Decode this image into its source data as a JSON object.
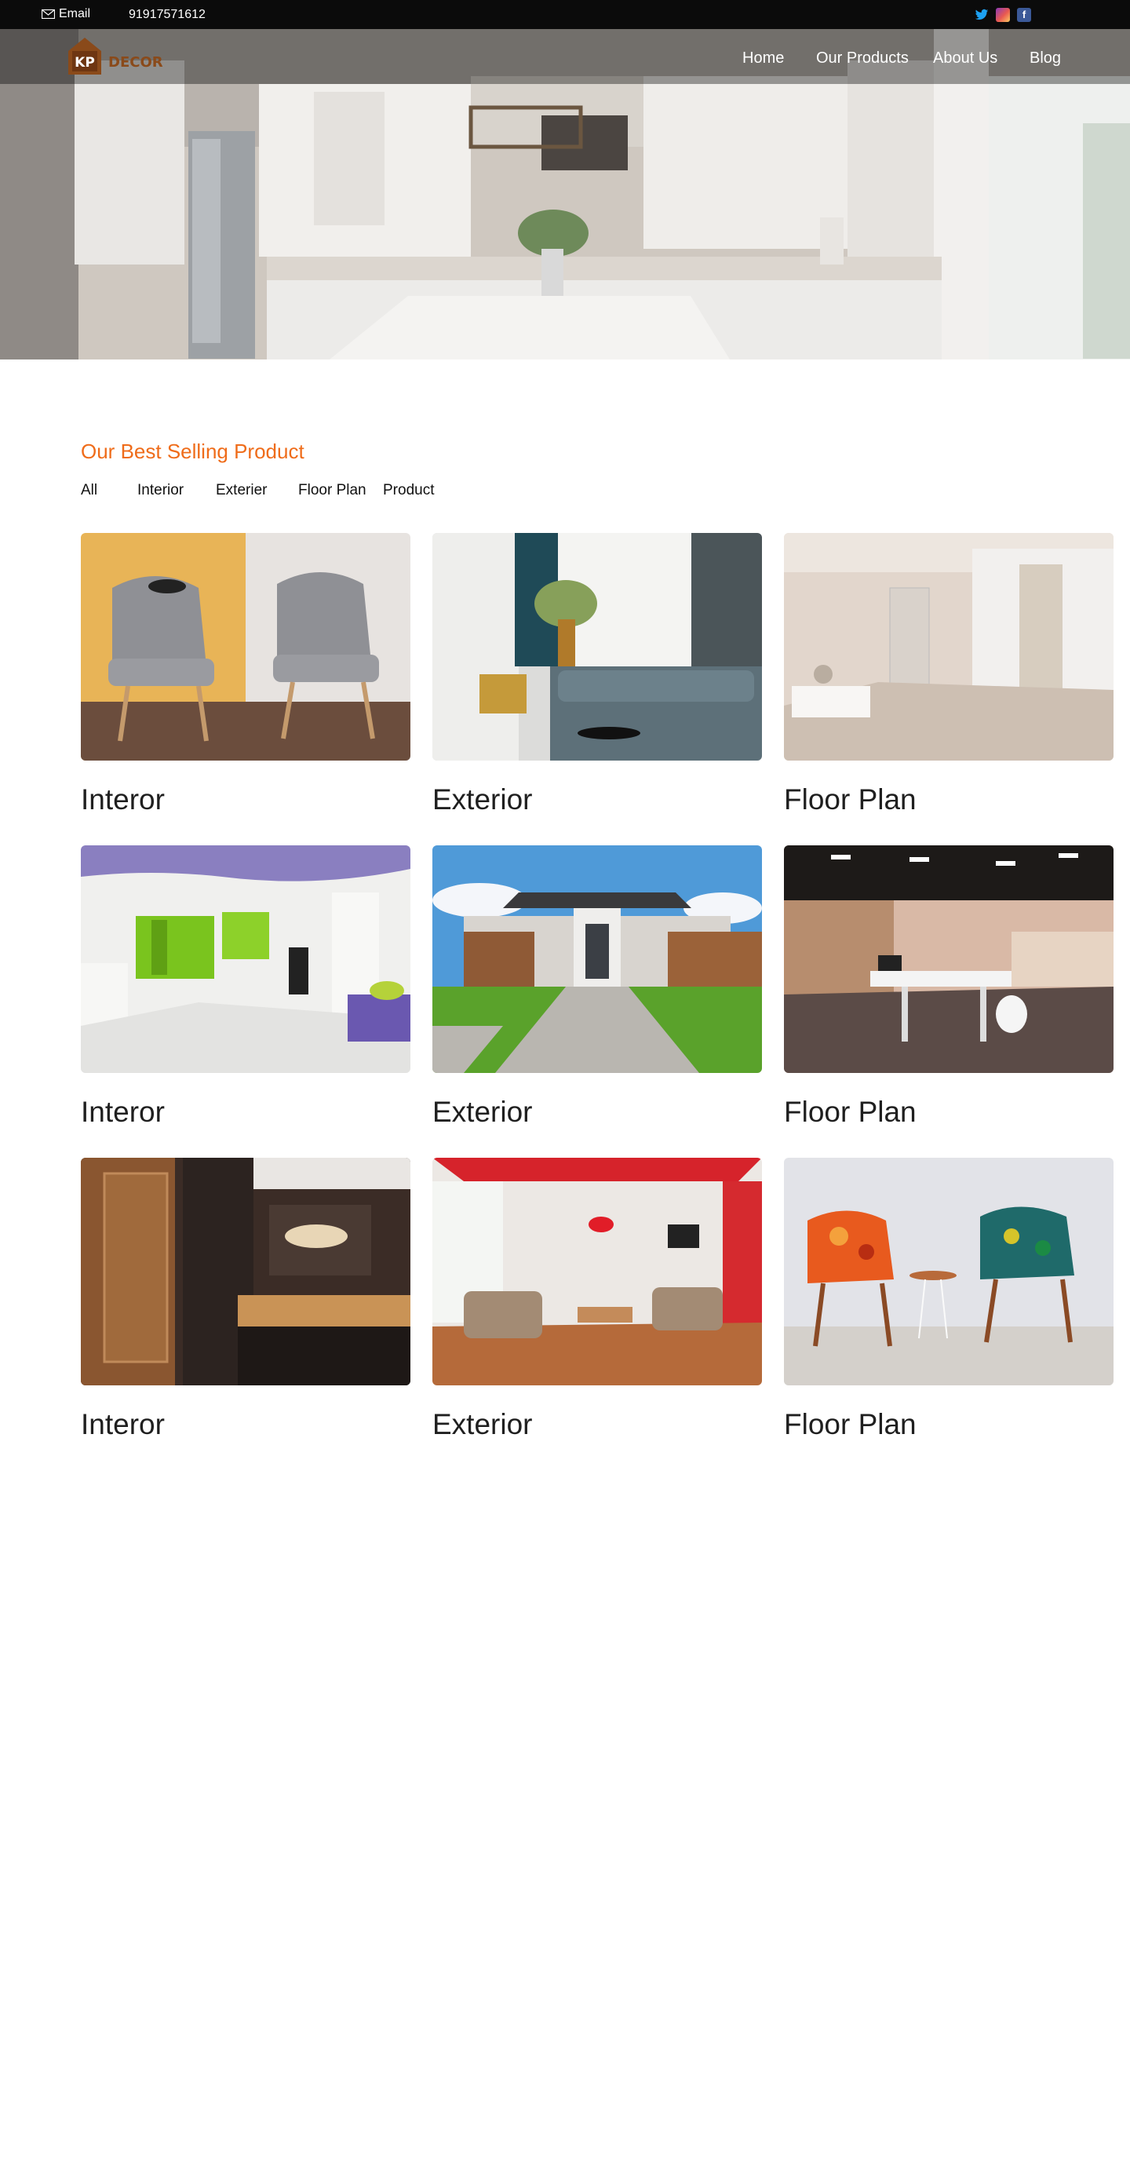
{
  "topbar": {
    "email_label": "Email",
    "phone": "91917571612",
    "social": [
      "twitter-icon",
      "instagram-icon",
      "facebook-icon"
    ]
  },
  "brand": {
    "logo_mark": "KP",
    "logo_word": "DECOR"
  },
  "nav": {
    "home": "Home",
    "products": "Our Products",
    "about": "About Us",
    "blog": "Blog"
  },
  "section": {
    "title": "Our Best Selling Product",
    "filters": [
      "All",
      "Interior",
      "Exterier",
      "Floor Plan",
      "Product"
    ]
  },
  "cards": [
    {
      "title": "Interor"
    },
    {
      "title": "Exterior"
    },
    {
      "title": "Floor Plan"
    },
    {
      "title": "Interor"
    },
    {
      "title": "Exterior"
    },
    {
      "title": "Floor Plan"
    },
    {
      "title": "Interor"
    },
    {
      "title": "Exterior"
    },
    {
      "title": "Floor Plan"
    }
  ],
  "colors": {
    "accent": "#ef6c1a",
    "topbar": "#0b0b0b",
    "text": "#1f1f1f"
  }
}
